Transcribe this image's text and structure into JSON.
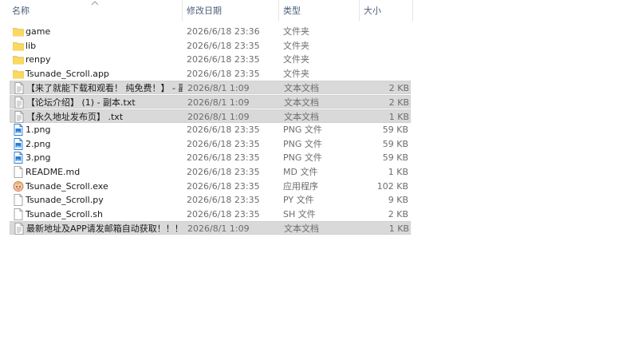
{
  "columns": {
    "name": "名称",
    "date": "修改日期",
    "type": "类型",
    "size": "大小"
  },
  "files": [
    {
      "name": "game",
      "date": "2026/6/18 23:36",
      "type": "文件夹",
      "size": "",
      "icon": "folder-icon",
      "selected": false
    },
    {
      "name": "lib",
      "date": "2026/6/18 23:35",
      "type": "文件夹",
      "size": "",
      "icon": "folder-icon",
      "selected": false
    },
    {
      "name": "renpy",
      "date": "2026/6/18 23:35",
      "type": "文件夹",
      "size": "",
      "icon": "folder-icon",
      "selected": false
    },
    {
      "name": "Tsunade_Scroll.app",
      "date": "2026/6/18 23:35",
      "type": "文件夹",
      "size": "",
      "icon": "folder-icon",
      "selected": false
    },
    {
      "name": "【来了就能下载和观看！ 纯免费！】 - 副...",
      "date": "2026/8/1 1:09",
      "type": "文本文档",
      "size": "2 KB",
      "icon": "text-file-icon",
      "selected": true
    },
    {
      "name": "【论坛介绍】 (1) - 副本.txt",
      "date": "2026/8/1 1:09",
      "type": "文本文档",
      "size": "2 KB",
      "icon": "text-file-icon",
      "selected": true
    },
    {
      "name": "【永久地址发布页】 .txt",
      "date": "2026/8/1 1:09",
      "type": "文本文档",
      "size": "1 KB",
      "icon": "text-file-icon",
      "selected": true
    },
    {
      "name": "1.png",
      "date": "2026/6/18 23:35",
      "type": "PNG 文件",
      "size": "59 KB",
      "icon": "image-file-icon",
      "selected": false
    },
    {
      "name": "2.png",
      "date": "2026/6/18 23:35",
      "type": "PNG 文件",
      "size": "59 KB",
      "icon": "image-file-icon",
      "selected": false
    },
    {
      "name": "3.png",
      "date": "2026/6/18 23:35",
      "type": "PNG 文件",
      "size": "59 KB",
      "icon": "image-file-icon",
      "selected": false
    },
    {
      "name": "README.md",
      "date": "2026/6/18 23:35",
      "type": "MD 文件",
      "size": "1 KB",
      "icon": "blank-file-icon",
      "selected": false
    },
    {
      "name": "Tsunade_Scroll.exe",
      "date": "2026/6/18 23:35",
      "type": "应用程序",
      "size": "102 KB",
      "icon": "app-icon",
      "selected": false
    },
    {
      "name": "Tsunade_Scroll.py",
      "date": "2026/6/18 23:35",
      "type": "PY 文件",
      "size": "9 KB",
      "icon": "blank-file-icon",
      "selected": false
    },
    {
      "name": "Tsunade_Scroll.sh",
      "date": "2026/6/18 23:35",
      "type": "SH 文件",
      "size": "2 KB",
      "icon": "blank-file-icon",
      "selected": false
    },
    {
      "name": "最新地址及APP请发邮箱自动获取！！！...",
      "date": "2026/8/1 1:09",
      "type": "文本文档",
      "size": "1 KB",
      "icon": "text-file-icon",
      "selected": true
    }
  ],
  "colors": {
    "header_text": "#4c607a",
    "selection": "#d9d9d9",
    "folder": "#f8d775",
    "image_icon": "#2b7cd3"
  }
}
